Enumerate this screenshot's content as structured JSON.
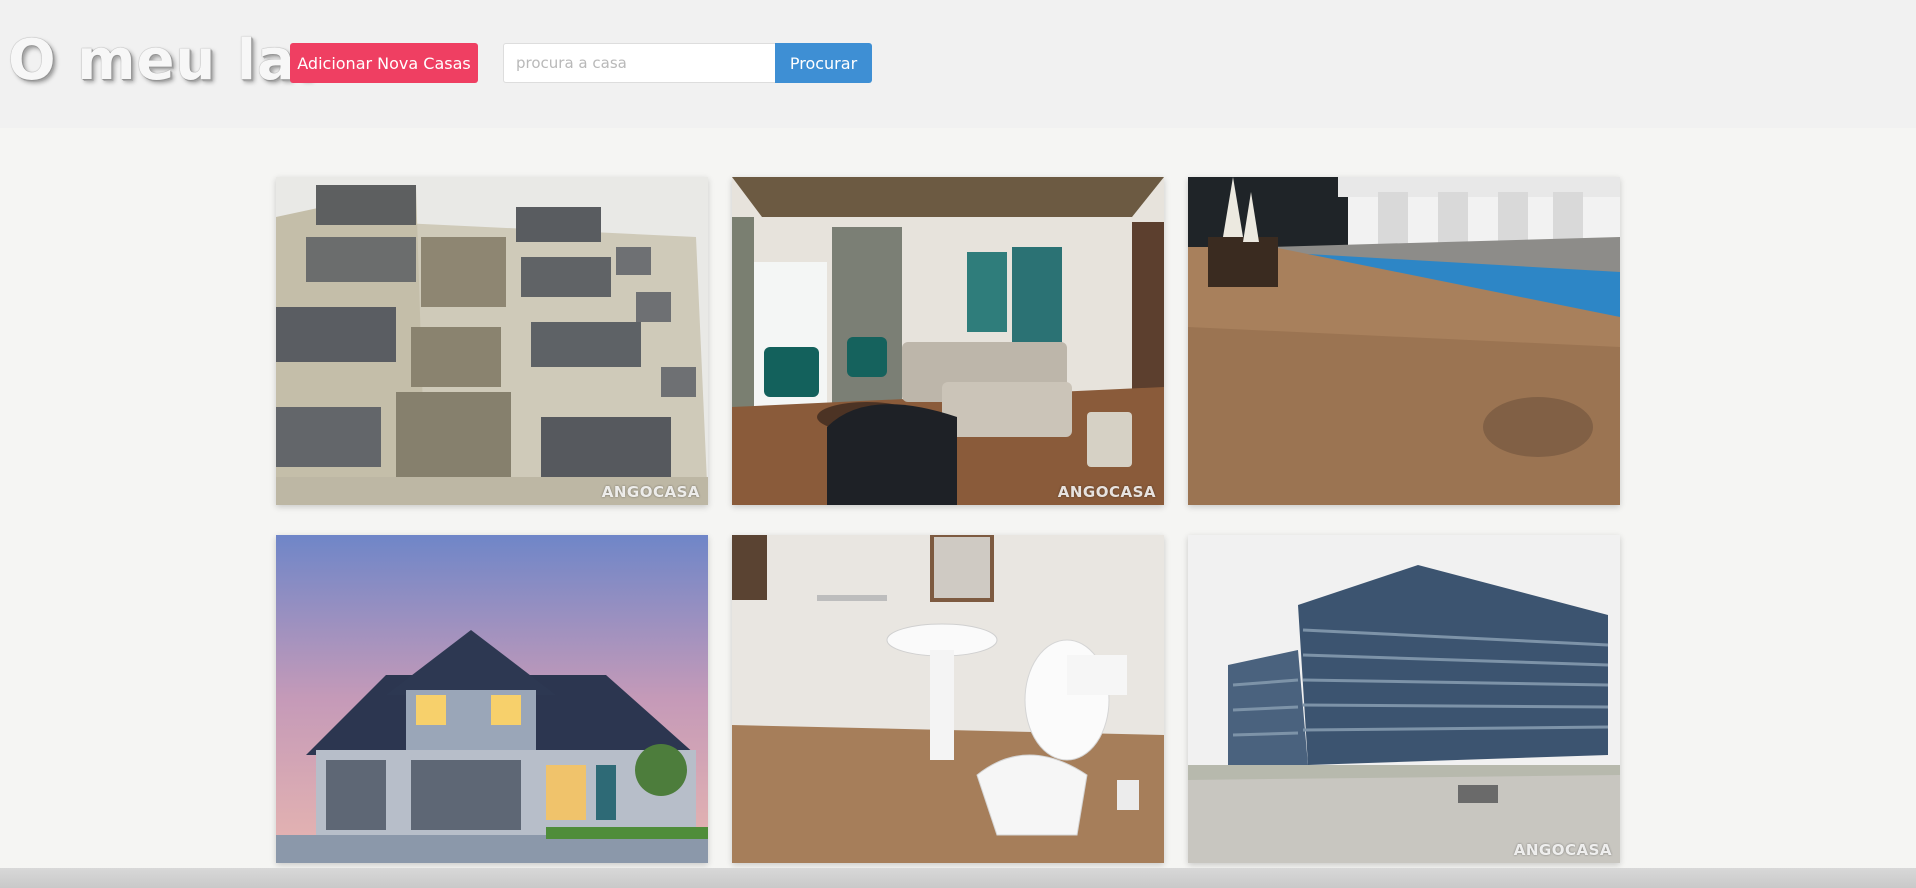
{
  "header": {
    "logo": "O meu lar",
    "add_button_label": "Adicionar Nova Casas",
    "search_placeholder": "procura a casa",
    "search_value": "",
    "search_button_label": "Procurar"
  },
  "colors": {
    "add_button": "#ef3f62",
    "search_button": "#3e8fd4"
  },
  "listings": [
    {
      "id": "apartment-block",
      "watermark": "ANGOCASA"
    },
    {
      "id": "living-room",
      "watermark": "ANGOCASA"
    },
    {
      "id": "pool-deck",
      "watermark": ""
    },
    {
      "id": "suburban-house",
      "watermark": ""
    },
    {
      "id": "bathroom",
      "watermark": ""
    },
    {
      "id": "modern-building",
      "watermark": "ANGOCASA"
    }
  ]
}
